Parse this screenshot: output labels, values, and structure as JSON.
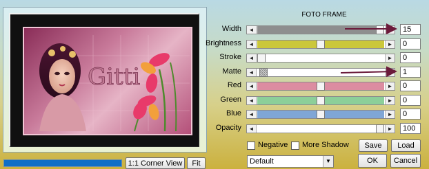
{
  "title": "FOTO FRAME",
  "preview": {
    "text": "Gitti"
  },
  "rows": [
    {
      "label": "Width",
      "value": "15",
      "level": 1.0,
      "color": "#8e8e8e"
    },
    {
      "label": "Brightness",
      "value": "0",
      "level": 0.5,
      "color": "#cbc73a"
    },
    {
      "label": "Stroke",
      "value": "0",
      "level": 0.0,
      "color": "#ffffff"
    },
    {
      "label": "Matte",
      "value": "1",
      "level": 0.02,
      "color": "#ffffff"
    },
    {
      "label": "Red",
      "value": "0",
      "level": 0.5,
      "color": "#dc8ca1"
    },
    {
      "label": "Green",
      "value": "0",
      "level": 0.5,
      "color": "#8ccf99"
    },
    {
      "label": "Blue",
      "value": "0",
      "level": 0.5,
      "color": "#7fa6d6"
    },
    {
      "label": "Opacity",
      "value": "100",
      "level": 1.0,
      "color": "#ffffff"
    }
  ],
  "checkboxes": {
    "negative": "Negative",
    "more_shadow": "More Shadow"
  },
  "buttons": {
    "save": "Save",
    "load": "Load",
    "ok": "OK",
    "cancel": "Cancel",
    "corner_view": "1:1 Corner View",
    "fit": "Fit"
  },
  "preset_select": {
    "value": "Default"
  },
  "arrow_color": "#6b1b3b"
}
